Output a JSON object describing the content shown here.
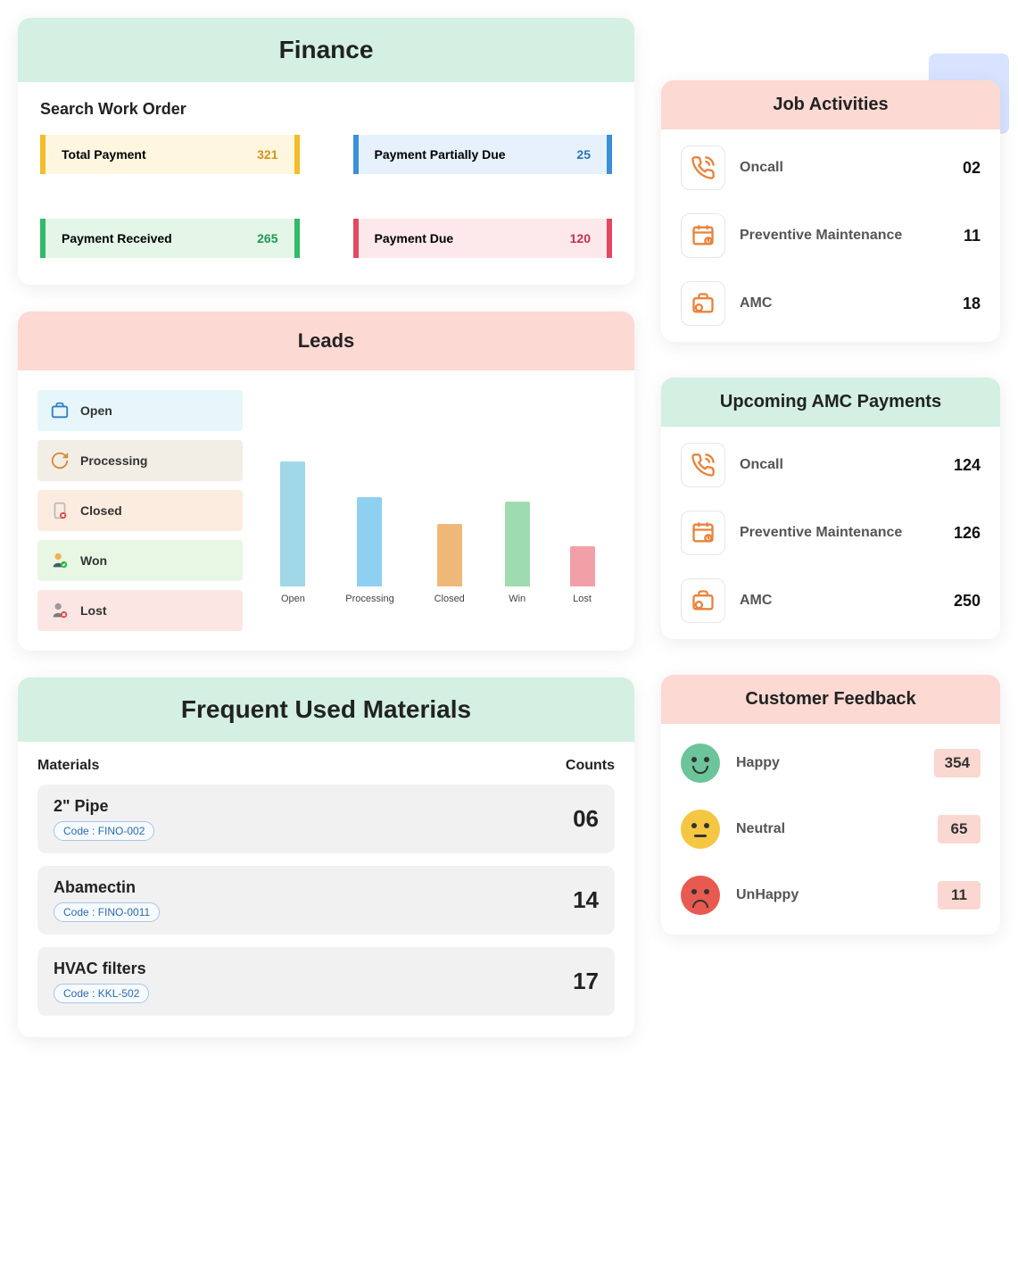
{
  "finance": {
    "title": "Finance",
    "subtitle": "Search Work Order",
    "tiles": [
      {
        "label": "Total Payment",
        "value": "321"
      },
      {
        "label": "Payment Partially Due",
        "value": "25"
      },
      {
        "label": "Payment Received",
        "value": "265"
      },
      {
        "label": "Payment Due",
        "value": "120"
      }
    ]
  },
  "leads": {
    "title": "Leads",
    "items": [
      {
        "label": "Open"
      },
      {
        "label": "Processing"
      },
      {
        "label": "Closed"
      },
      {
        "label": "Won"
      },
      {
        "label": "Lost"
      }
    ]
  },
  "chart_data": {
    "type": "bar",
    "title": "Leads",
    "categories": [
      "Open",
      "Processing",
      "Closed",
      "Win",
      "Lost"
    ],
    "values": [
      140,
      100,
      70,
      95,
      45
    ],
    "colors": [
      "#a0d8e8",
      "#8fcff0",
      "#f0b878",
      "#9fdbb1",
      "#f29fa8"
    ],
    "xlabel": "",
    "ylabel": "",
    "ylim": [
      0,
      160
    ]
  },
  "materials": {
    "title": "Frequent Used Materials",
    "header_left": "Materials",
    "header_right": "Counts",
    "code_prefix": "Code :",
    "rows": [
      {
        "name": "2\" Pipe",
        "code": "FINO-002",
        "count": "06"
      },
      {
        "name": "Abamectin",
        "code": "FINO-0011",
        "count": "14"
      },
      {
        "name": "HVAC filters",
        "code": "KKL-502",
        "count": "17"
      }
    ]
  },
  "job_activities": {
    "title": "Job Activities",
    "rows": [
      {
        "label": "Oncall",
        "value": "02"
      },
      {
        "label": "Preventive Maintenance",
        "value": "11"
      },
      {
        "label": "AMC",
        "value": "18"
      }
    ]
  },
  "amc_payments": {
    "title": "Upcoming AMC Payments",
    "rows": [
      {
        "label": "Oncall",
        "value": "124"
      },
      {
        "label": "Preventive Maintenance",
        "value": "126"
      },
      {
        "label": "AMC",
        "value": "250"
      }
    ]
  },
  "feedback": {
    "title": "Customer Feedback",
    "rows": [
      {
        "label": "Happy",
        "value": "354"
      },
      {
        "label": "Neutral",
        "value": "65"
      },
      {
        "label": "UnHappy",
        "value": "11"
      }
    ]
  }
}
